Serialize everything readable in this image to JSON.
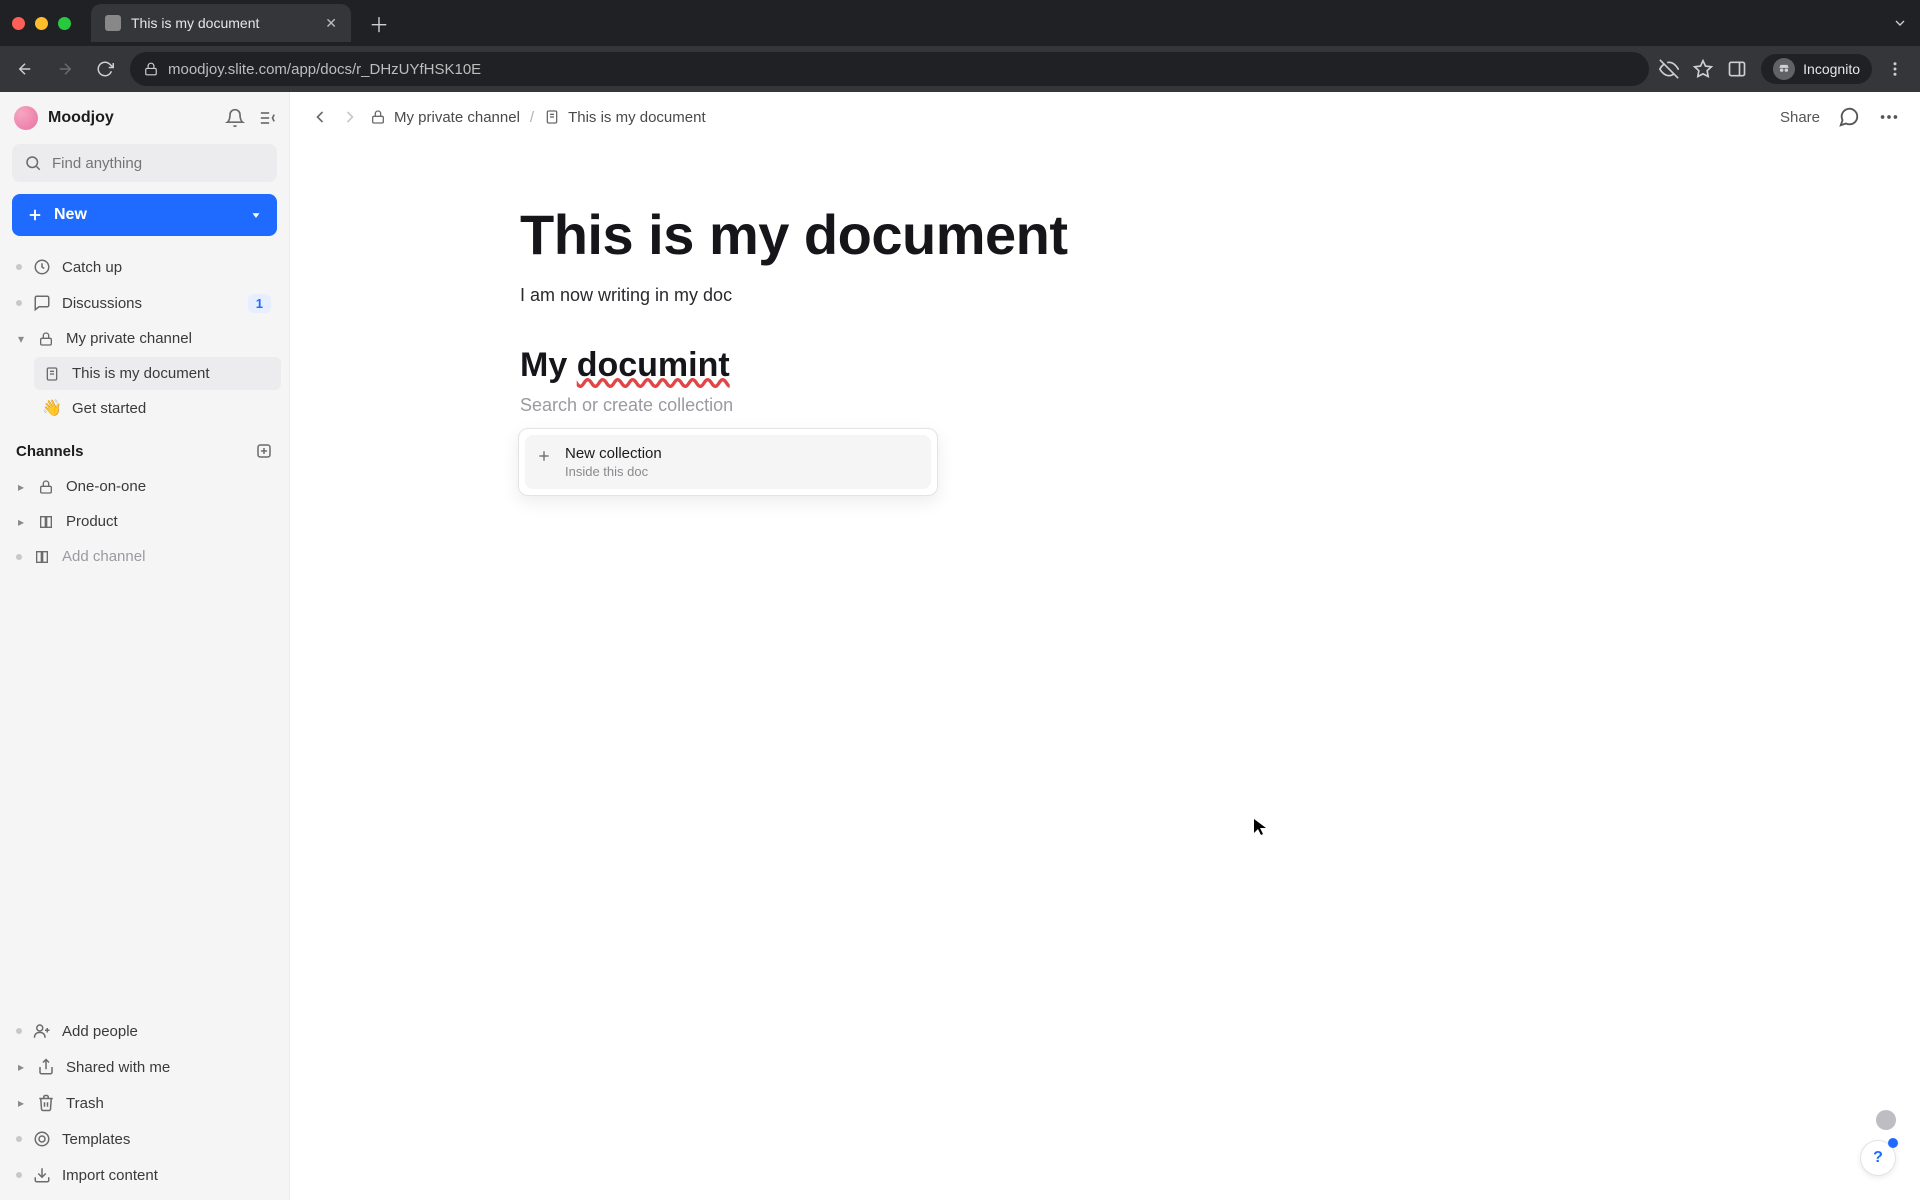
{
  "browser": {
    "tab_title": "This is my document",
    "url": "moodjoy.slite.com/app/docs/r_DHzUYfHSK10E",
    "incognito_label": "Incognito"
  },
  "workspace": {
    "name": "Moodjoy"
  },
  "search": {
    "placeholder": "Find anything"
  },
  "new_button": {
    "label": "New"
  },
  "sidebar": {
    "catch_up": "Catch up",
    "discussions": "Discussions",
    "discussions_badge": "1",
    "private_channel": "My private channel",
    "doc_item": "This is my document",
    "get_started": "Get started",
    "channels_header": "Channels",
    "one_on_one": "One-on-one",
    "product": "Product",
    "add_channel": "Add channel",
    "add_people": "Add people",
    "shared_with_me": "Shared with me",
    "trash": "Trash",
    "templates": "Templates",
    "import_content": "Import content"
  },
  "breadcrumbs": {
    "channel": "My private channel",
    "doc": "This is my document"
  },
  "topbar": {
    "share": "Share"
  },
  "document": {
    "title": "This is my document",
    "body_line": "I am now writing in my doc",
    "heading_prefix": "My ",
    "heading_misspelled": "documint",
    "search_placeholder": "Search or create collection"
  },
  "popover": {
    "title": "New collection",
    "subtitle": "Inside this doc"
  },
  "emoji": {
    "wave": "👋"
  },
  "help": {
    "label": "?"
  }
}
